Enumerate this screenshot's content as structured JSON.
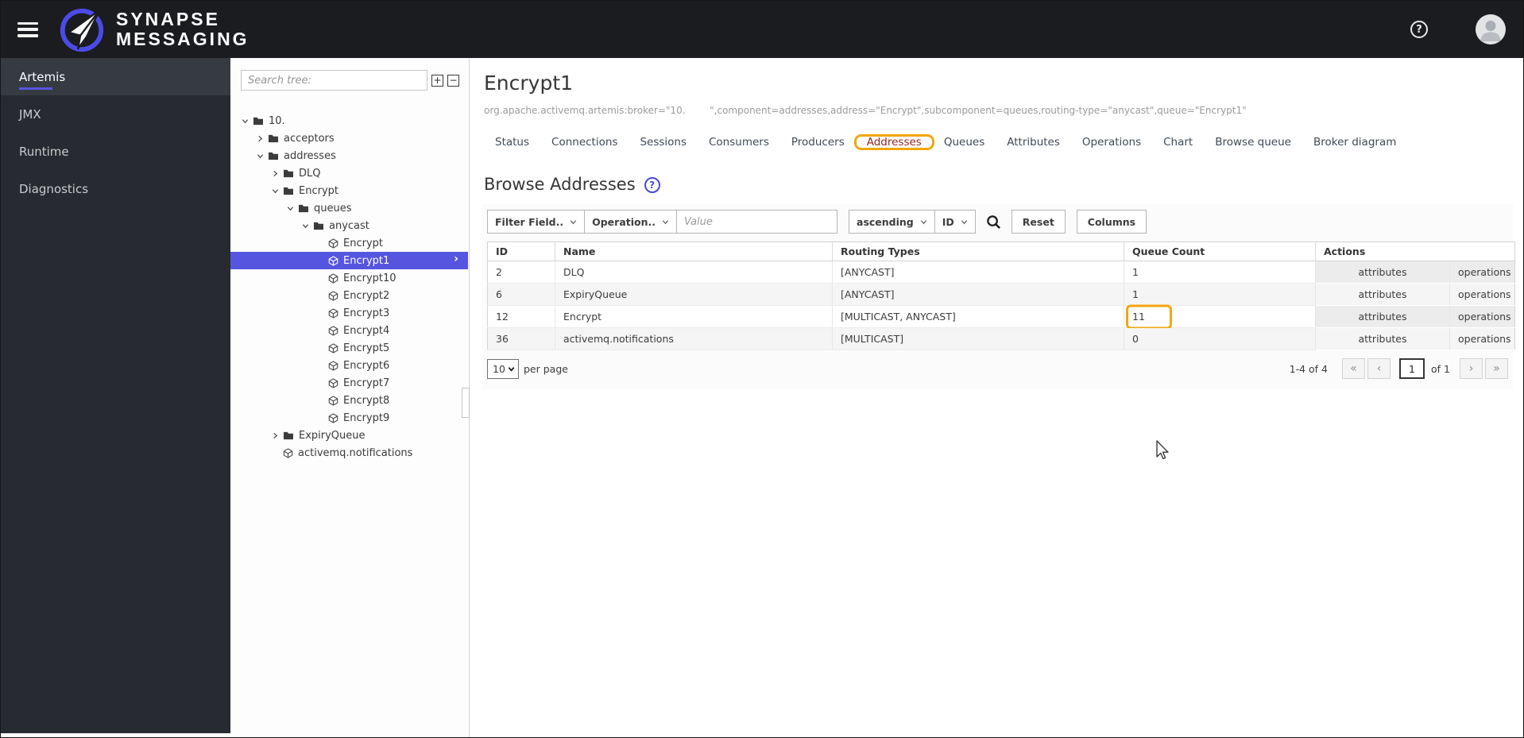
{
  "header": {
    "brand_line1": "SYNAPSE",
    "brand_line2": "MESSAGING",
    "help_glyph": "?"
  },
  "sidebar": {
    "items": [
      {
        "label": "Artemis",
        "active": true
      },
      {
        "label": "JMX",
        "active": false
      },
      {
        "label": "Runtime",
        "active": false
      },
      {
        "label": "Diagnostics",
        "active": false
      }
    ]
  },
  "tree": {
    "search_placeholder": "Search tree:",
    "expand_glyph": "+",
    "collapse_glyph": "−",
    "nodes": [
      {
        "label": "10.",
        "level": 0,
        "icon": "folder",
        "caret": "down"
      },
      {
        "label": "acceptors",
        "level": 1,
        "icon": "folder",
        "caret": "right"
      },
      {
        "label": "addresses",
        "level": 1,
        "icon": "folder",
        "caret": "down"
      },
      {
        "label": "DLQ",
        "level": 2,
        "icon": "folder",
        "caret": "right"
      },
      {
        "label": "Encrypt",
        "level": 2,
        "icon": "folder",
        "caret": "down"
      },
      {
        "label": "queues",
        "level": 3,
        "icon": "folder",
        "caret": "down"
      },
      {
        "label": "anycast",
        "level": 4,
        "icon": "folder",
        "caret": "down"
      },
      {
        "label": "Encrypt",
        "level": 5,
        "icon": "cube",
        "caret": "none"
      },
      {
        "label": "Encrypt1",
        "level": 5,
        "icon": "cube",
        "caret": "none",
        "selected": true
      },
      {
        "label": "Encrypt10",
        "level": 5,
        "icon": "cube",
        "caret": "none"
      },
      {
        "label": "Encrypt2",
        "level": 5,
        "icon": "cube",
        "caret": "none"
      },
      {
        "label": "Encrypt3",
        "level": 5,
        "icon": "cube",
        "caret": "none"
      },
      {
        "label": "Encrypt4",
        "level": 5,
        "icon": "cube",
        "caret": "none"
      },
      {
        "label": "Encrypt5",
        "level": 5,
        "icon": "cube",
        "caret": "none"
      },
      {
        "label": "Encrypt6",
        "level": 5,
        "icon": "cube",
        "caret": "none"
      },
      {
        "label": "Encrypt7",
        "level": 5,
        "icon": "cube",
        "caret": "none"
      },
      {
        "label": "Encrypt8",
        "level": 5,
        "icon": "cube",
        "caret": "none"
      },
      {
        "label": "Encrypt9",
        "level": 5,
        "icon": "cube",
        "caret": "none"
      },
      {
        "label": "ExpiryQueue",
        "level": 2,
        "icon": "folder",
        "caret": "right"
      },
      {
        "label": "activemq.notifications",
        "level": 2,
        "icon": "cube",
        "caret": "none"
      }
    ]
  },
  "main": {
    "title": "Encrypt1",
    "breadcrumb": "org.apache.activemq.artemis:broker=\"10.        \",component=addresses,address=\"Encrypt\",subcomponent=queues,routing-type=\"anycast\",queue=\"Encrypt1\"",
    "tabs": [
      {
        "label": "Status"
      },
      {
        "label": "Connections"
      },
      {
        "label": "Sessions"
      },
      {
        "label": "Consumers"
      },
      {
        "label": "Producers"
      },
      {
        "label": "Addresses",
        "active": true,
        "annotated": true
      },
      {
        "label": "Queues"
      },
      {
        "label": "Attributes"
      },
      {
        "label": "Operations"
      },
      {
        "label": "Chart"
      },
      {
        "label": "Browse queue"
      },
      {
        "label": "Broker diagram"
      }
    ],
    "section_title": "Browse Addresses",
    "help_glyph": "?",
    "toolbar": {
      "filter_field": "Filter Field..",
      "operation": "Operation..",
      "value_placeholder": "Value",
      "sort_order": "ascending",
      "sort_field": "ID",
      "reset_label": "Reset",
      "columns_label": "Columns"
    },
    "table": {
      "headers": [
        "ID",
        "Name",
        "Routing Types",
        "Queue Count",
        "Actions"
      ],
      "action_labels": [
        "attributes",
        "operations"
      ],
      "rows": [
        {
          "id": "2",
          "name": "DLQ",
          "routing": "[ANYCAST]",
          "count": "1"
        },
        {
          "id": "6",
          "name": "ExpiryQueue",
          "routing": "[ANYCAST]",
          "count": "1"
        },
        {
          "id": "12",
          "name": "Encrypt",
          "routing": "[MULTICAST, ANYCAST]",
          "count": "11",
          "annotated": true
        },
        {
          "id": "36",
          "name": "activemq.notifications",
          "routing": "[MULTICAST]",
          "count": "0"
        }
      ]
    },
    "pagination": {
      "per_page": "10",
      "per_page_label": "per page",
      "range": "1-4 of 4",
      "first_glyph": "«",
      "prev_glyph": "‹",
      "page": "1",
      "of_label": "of 1",
      "next_glyph": "›",
      "last_glyph": "»"
    }
  },
  "colors": {
    "accent": "#5655e0",
    "annotation_orange": "#f2a60d",
    "masthead_bg": "#1a1c20",
    "sidebar_bg": "#272b31",
    "tab_active_text": "#97271b",
    "selected_row_bg": "#5655e0"
  }
}
